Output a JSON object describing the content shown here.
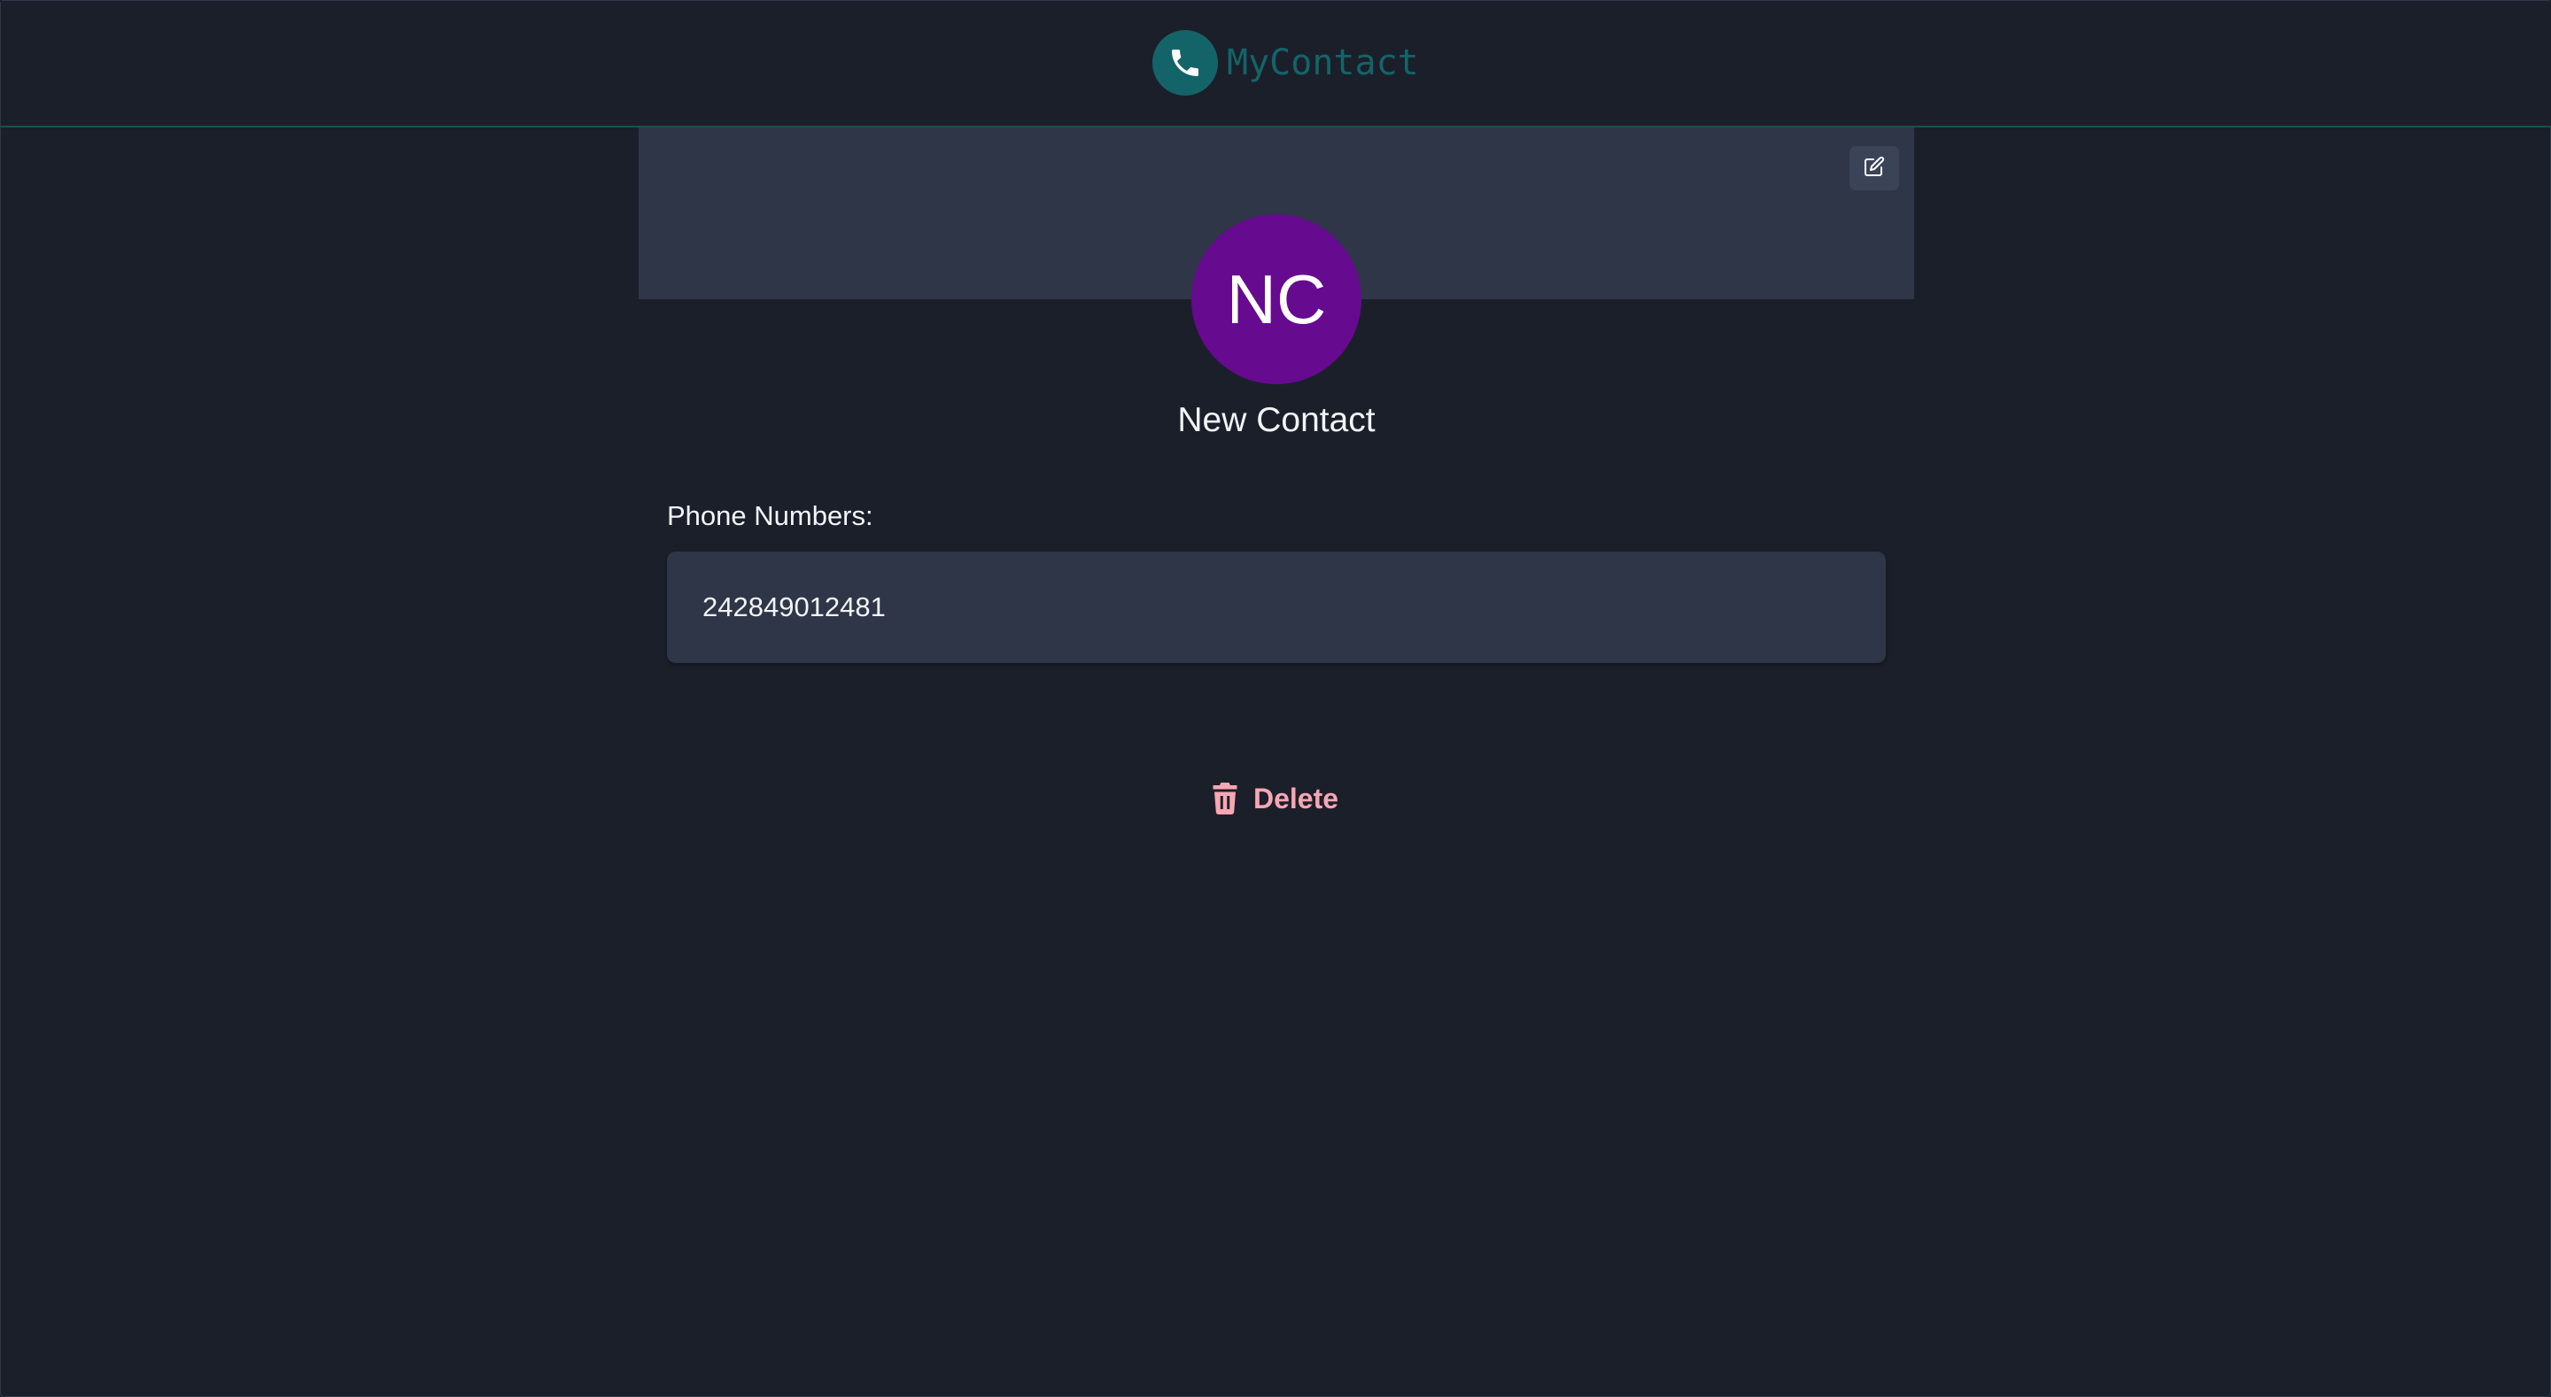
{
  "header": {
    "app_name": "MyContact",
    "logo_icon": "phone-icon"
  },
  "banner": {
    "edit_icon": "edit-icon"
  },
  "contact": {
    "initials": "NC",
    "name": "New Contact",
    "avatar_color": "#660a8f"
  },
  "phones": {
    "label": "Phone Numbers:",
    "items": [
      "242849012481"
    ]
  },
  "actions": {
    "delete_label": "Delete",
    "delete_icon": "trash-icon",
    "delete_color": "#f7a6b3"
  },
  "colors": {
    "background": "#1b1f2a",
    "panel": "#2e3647",
    "brand": "#136468"
  }
}
